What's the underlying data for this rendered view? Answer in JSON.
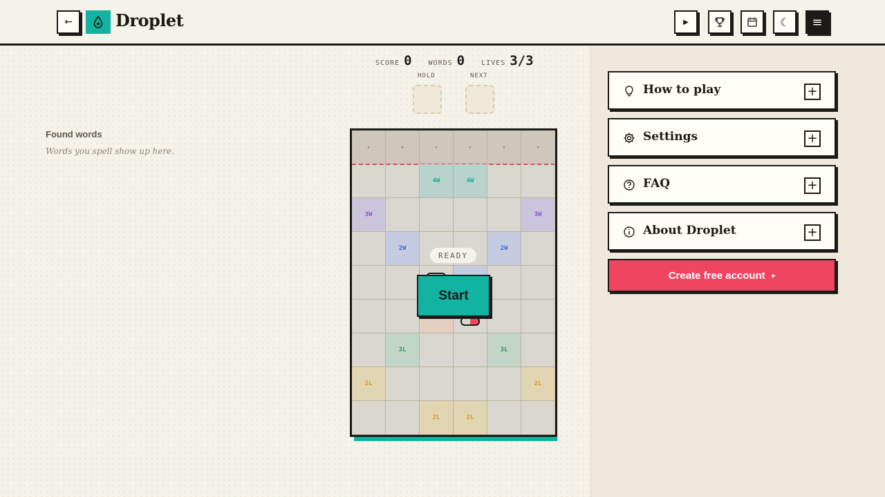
{
  "header": {
    "brand": "Droplet",
    "back_icon": "←",
    "play_icon": "▶",
    "trophy_icon": "trophy",
    "calendar_icon": "calendar",
    "theme_icon": "☾",
    "menu_icon": "≡"
  },
  "found": {
    "title": "Found words",
    "subtitle": "Words you spell show up here."
  },
  "stats": {
    "score_label": "SCORE",
    "score": "0",
    "words_label": "WORDS",
    "words": "0",
    "lives_label": "LIVES",
    "lives": "3/3"
  },
  "slots": {
    "hold_label": "HOLD",
    "next_label": "NEXT"
  },
  "board": {
    "drop_marker": "▾",
    "ready": "READY",
    "start_label": "Start",
    "cells": [
      [
        "",
        "",
        "4W",
        "4W",
        "",
        ""
      ],
      [
        "3W",
        "",
        "",
        "",
        "",
        "3W"
      ],
      [
        "",
        "2W",
        "",
        "",
        "2W",
        ""
      ],
      [
        "",
        "",
        "",
        "",
        "",
        ""
      ],
      [
        "",
        "",
        "",
        "",
        "",
        ""
      ],
      [
        "",
        "3L",
        "",
        "",
        "3L",
        ""
      ],
      [
        "2L",
        "",
        "",
        "",
        "",
        "2L"
      ],
      [
        "",
        "",
        "2L",
        "2L",
        "",
        ""
      ]
    ]
  },
  "colors": {
    "accent": "#13b3a2",
    "cta": "#ef4560",
    "4W": "#19a89a",
    "3W": "#8a4fd4",
    "2W": "#3c6ad8",
    "3L": "#2e8f5e",
    "2L": "#d99a12"
  },
  "sidebar": {
    "items": [
      {
        "label": "How to play",
        "icon": "lightbulb-icon"
      },
      {
        "label": "Settings",
        "icon": "gear-icon"
      },
      {
        "label": "FAQ",
        "icon": "question-circle-icon"
      },
      {
        "label": "About Droplet",
        "icon": "info-circle-icon"
      }
    ],
    "expand_icon": "+",
    "cta_label": "Create free account",
    "cta_arrow": "▸"
  }
}
